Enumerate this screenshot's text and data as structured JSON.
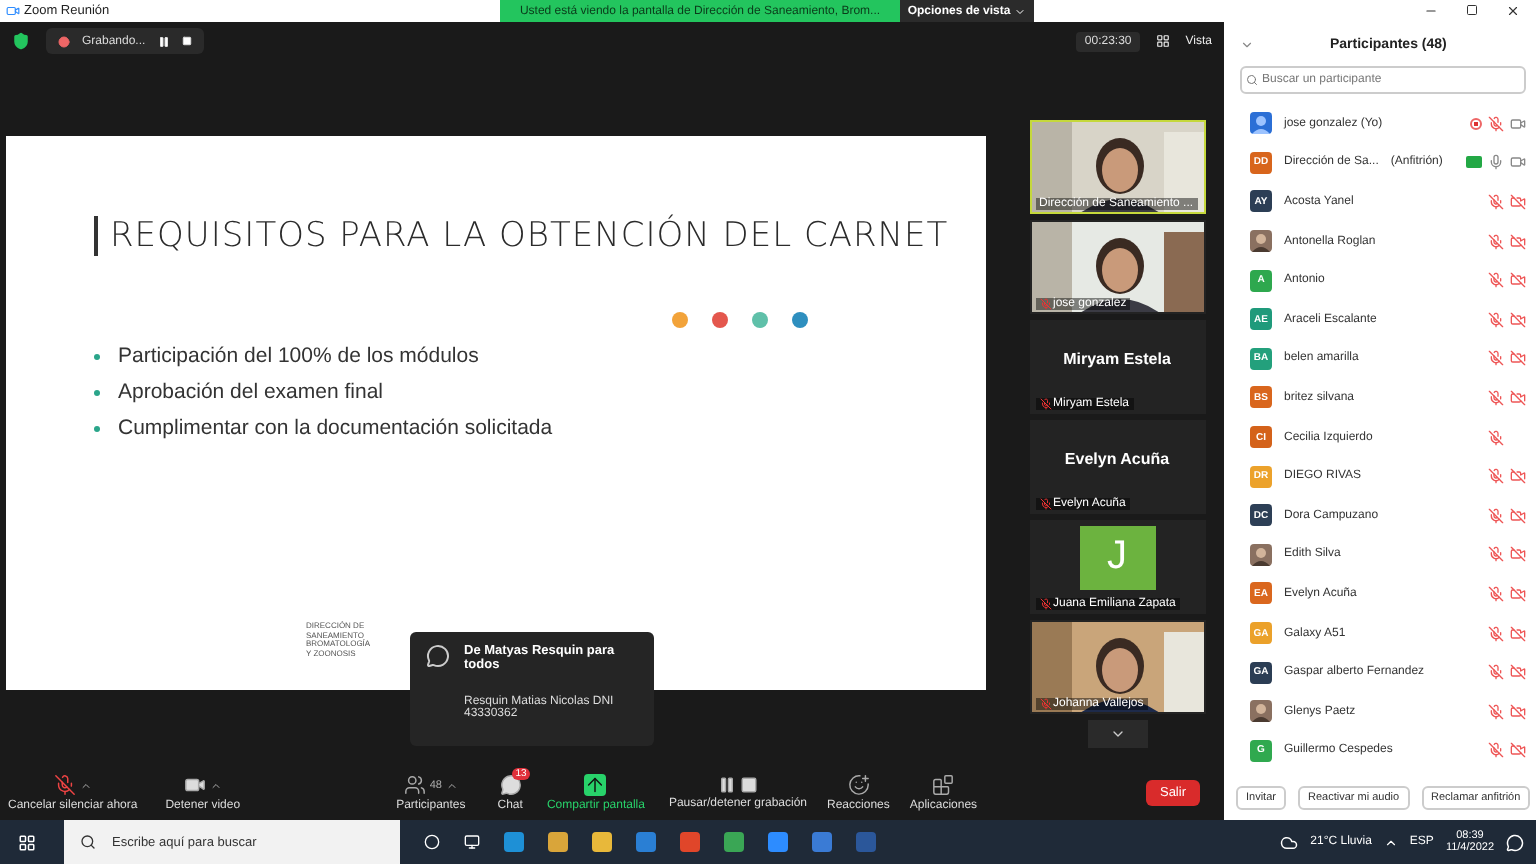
{
  "window": {
    "title": "Zoom Reunión",
    "banner": "Usted está viendo la pantalla de Dirección de Saneamiento, Brom...",
    "view_options": "Opciones de vista"
  },
  "meeting_bar": {
    "recording": "Grabando...",
    "timer": "00:23:30",
    "view": "Vista"
  },
  "slide": {
    "title": "REQUISITOS PARA LA OBTENCIÓN DEL CARNET",
    "dots": [
      {
        "color": "#f2a33a"
      },
      {
        "color": "#e4574d"
      },
      {
        "color": "#5fc0a9"
      },
      {
        "color": "#2e8fbf"
      }
    ],
    "bullets": [
      "Participación del 100% de los módulos",
      "Aprobación del examen final",
      "Cumplimentar con la documentación solicitada"
    ],
    "footer": "DIRECCIÓN DE SANEAMIENTO BROMATOLOGÍA Y ZOONOSIS"
  },
  "chat_toast": {
    "sender": "De Matyas Resquin para todos",
    "message": "Resquin Matias Nicolas DNI 43330362"
  },
  "video_tiles": [
    {
      "kind": "video",
      "name": "Dirección de Saneamiento ...",
      "speaking": true,
      "muted": false
    },
    {
      "kind": "video",
      "name": "jose gonzalez",
      "speaking": false,
      "muted": true
    },
    {
      "kind": "name",
      "display": "Miryam Estela",
      "name": "Miryam Estela",
      "speaking": false,
      "muted": true
    },
    {
      "kind": "name",
      "display": "Evelyn Acuña",
      "name": "Evelyn Acuña",
      "speaking": false,
      "muted": true
    },
    {
      "kind": "initial",
      "display": "J",
      "name": "Juana Emiliana Zapata",
      "speaking": false,
      "muted": true
    },
    {
      "kind": "video",
      "name": "Johanna Vallejos",
      "speaking": false,
      "muted": true
    }
  ],
  "toolbar": [
    {
      "kind": "mic",
      "label": "Cancelar silenciar ahora",
      "menu": true
    },
    {
      "kind": "video",
      "label": "Detener video",
      "menu": true
    },
    {
      "kind": "participants",
      "label": "Participantes",
      "count": "48",
      "menu": true
    },
    {
      "kind": "chat",
      "label": "Chat",
      "badge": "13",
      "menu": false
    },
    {
      "kind": "share",
      "label": "Compartir pantalla",
      "menu": false
    },
    {
      "kind": "record",
      "label": "Pausar/detener grabación",
      "menu": false
    },
    {
      "kind": "reactions",
      "label": "Reacciones",
      "menu": false
    },
    {
      "kind": "apps",
      "label": "Aplicaciones",
      "menu": false
    }
  ],
  "leave_button": "Salir",
  "participants_panel": {
    "title": "Participantes (48)",
    "search": {
      "placeholder": "Buscar un participante"
    },
    "participants": [
      {
        "name": "jose gonzalez (Yo)",
        "photo": true,
        "recording": true,
        "muted": true,
        "video_on": true
      },
      {
        "name": "Dirección de Sa...",
        "role": "(Anfitrión)",
        "sharing": true,
        "photo": false,
        "initials": "DD",
        "color": "#d8651c",
        "muted": false,
        "video_on": true
      },
      {
        "name": "Acosta Yanel",
        "photo": false,
        "initials": "AY",
        "color": "#2c3e55",
        "muted": true,
        "video_on": false
      },
      {
        "name": "Antonella Roglan",
        "photo": true,
        "muted": true,
        "video_on": false
      },
      {
        "name": "Antonio",
        "photo": false,
        "initials": "A",
        "color": "#2ea84e",
        "muted": true,
        "video_on": false
      },
      {
        "name": "Araceli Escalante",
        "photo": false,
        "initials": "AE",
        "color": "#1f9a7b",
        "muted": true,
        "video_on": false
      },
      {
        "name": "belen amarilla",
        "photo": false,
        "initials": "BA",
        "color": "#23a07c",
        "muted": true,
        "video_on": false
      },
      {
        "name": "britez silvana",
        "photo": false,
        "initials": "BS",
        "color": "#d9661d",
        "muted": true,
        "video_on": false
      },
      {
        "name": "Cecilia Izquierdo",
        "photo": false,
        "initials": "CI",
        "color": "#d4621a",
        "muted": true
      },
      {
        "name": "DIEGO RIVAS",
        "photo": false,
        "initials": "DR",
        "color": "#eca22b",
        "muted": true,
        "video_on": false
      },
      {
        "name": "Dora Campuzano",
        "photo": false,
        "initials": "DC",
        "color": "#2d3f56",
        "muted": true,
        "video_on": false
      },
      {
        "name": "Edith Silva",
        "photo": true,
        "muted": true,
        "video_on": false
      },
      {
        "name": "Evelyn Acuña",
        "photo": false,
        "initials": "EA",
        "color": "#da671e",
        "muted": true,
        "video_on": false
      },
      {
        "name": "Galaxy A51",
        "photo": false,
        "initials": "GA",
        "color": "#eba12a",
        "muted": true,
        "video_on": false
      },
      {
        "name": "Gaspar alberto Fernandez",
        "photo": false,
        "initials": "GA",
        "color": "#2b3d54",
        "muted": true,
        "video_on": false
      },
      {
        "name": "Glenys Paetz",
        "photo": true,
        "muted": true,
        "video_on": false
      },
      {
        "name": "Guillermo Cespedes",
        "photo": false,
        "initials": "G",
        "color": "#30a94f",
        "muted": true,
        "video_on": false
      }
    ],
    "buttons": [
      "Invitar",
      "Reactivar mi audio",
      "Reclamar anfitrión"
    ]
  },
  "taskbar": {
    "search": {
      "placeholder": "Escribe aquí para buscar"
    },
    "weather": "21°C Lluvia",
    "language": "ESP",
    "time": "08:39",
    "date": "11/4/2022"
  }
}
